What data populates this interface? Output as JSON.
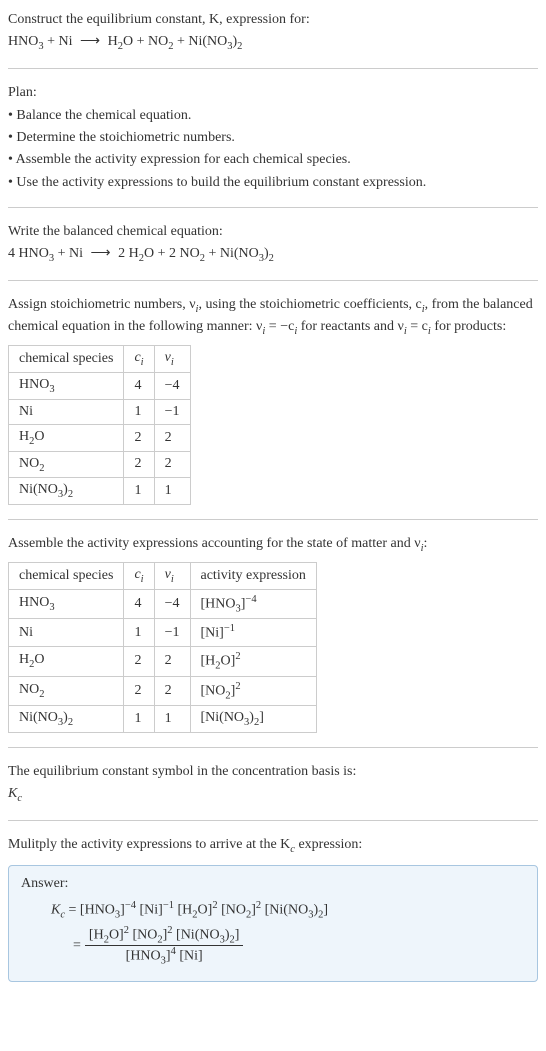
{
  "intro": {
    "l1": "Construct the equilibrium constant, K, expression for:",
    "eq_lhs1": "HNO",
    "eq_lhs1_sub": "3",
    "eq_plus1": " + Ni ",
    "arrow": "⟶",
    "eq_rhs1": " H",
    "eq_rhs1_sub": "2",
    "eq_rhs2": "O + NO",
    "eq_rhs2_sub": "2",
    "eq_rhs3": " + Ni(NO",
    "eq_rhs3_sub": "3",
    "eq_rhs4": ")",
    "eq_rhs4_sub": "2"
  },
  "plan": {
    "heading": "Plan:",
    "b1": "• Balance the chemical equation.",
    "b2": "• Determine the stoichiometric numbers.",
    "b3": "• Assemble the activity expression for each chemical species.",
    "b4": "• Use the activity expressions to build the equilibrium constant expression."
  },
  "balanced": {
    "heading": "Write the balanced chemical equation:",
    "l_a": "4 HNO",
    "l_a_sub": "3",
    "l_b": " + Ni ",
    "arrow": "⟶",
    "r_a": " 2 H",
    "r_a_sub": "2",
    "r_b": "O + 2 NO",
    "r_b_sub": "2",
    "r_c": " + Ni(NO",
    "r_c_sub": "3",
    "r_d": ")",
    "r_d_sub": "2"
  },
  "assign": {
    "p1a": "Assign stoichiometric numbers, ν",
    "p1a_sub": "i",
    "p1b": ", using the stoichiometric coefficients, c",
    "p1b_sub": "i",
    "p1c": ", from the balanced chemical equation in the following manner: ν",
    "p1c_sub": "i",
    "p1d": " = −c",
    "p1d_sub": "i",
    "p1e": " for reactants and ν",
    "p1e_sub": "i",
    "p1f": " = c",
    "p1f_sub": "i",
    "p1g": " for products:"
  },
  "table1": {
    "h1": "chemical species",
    "h2_a": "c",
    "h2_b": "i",
    "h3_a": "ν",
    "h3_b": "i",
    "rows": [
      {
        "sp_a": "HNO",
        "sp_sub": "3",
        "sp_c": "",
        "c": "4",
        "v": "−4"
      },
      {
        "sp_a": "Ni",
        "sp_sub": "",
        "sp_c": "",
        "c": "1",
        "v": "−1"
      },
      {
        "sp_a": "H",
        "sp_sub": "2",
        "sp_c": "O",
        "c": "2",
        "v": "2"
      },
      {
        "sp_a": "NO",
        "sp_sub": "2",
        "sp_c": "",
        "c": "2",
        "v": "2"
      },
      {
        "sp_a": "Ni(NO",
        "sp_sub": "3",
        "sp_c": ")",
        "sp_c_sub": "2",
        "c": "1",
        "v": "1"
      }
    ]
  },
  "assemble": {
    "heading_a": "Assemble the activity expressions accounting for the state of matter and ν",
    "heading_sub": "i",
    "heading_b": ":"
  },
  "table2": {
    "h1": "chemical species",
    "h2_a": "c",
    "h2_b": "i",
    "h3_a": "ν",
    "h3_b": "i",
    "h4": "activity expression",
    "rows": [
      {
        "sp_a": "HNO",
        "sp_sub": "3",
        "sp_c": "",
        "c": "4",
        "v": "−4",
        "ax_a": "[HNO",
        "ax_sub": "3",
        "ax_b": "]",
        "ax_sup": "−4"
      },
      {
        "sp_a": "Ni",
        "sp_sub": "",
        "sp_c": "",
        "c": "1",
        "v": "−1",
        "ax_a": "[Ni",
        "ax_sub": "",
        "ax_b": "]",
        "ax_sup": "−1"
      },
      {
        "sp_a": "H",
        "sp_sub": "2",
        "sp_c": "O",
        "c": "2",
        "v": "2",
        "ax_a": "[H",
        "ax_sub": "2",
        "ax_b": "O]",
        "ax_sup": "2"
      },
      {
        "sp_a": "NO",
        "sp_sub": "2",
        "sp_c": "",
        "c": "2",
        "v": "2",
        "ax_a": "[NO",
        "ax_sub": "2",
        "ax_b": "]",
        "ax_sup": "2"
      },
      {
        "sp_a": "Ni(NO",
        "sp_sub": "3",
        "sp_c": ")",
        "sp_c_sub": "2",
        "c": "1",
        "v": "1",
        "ax_a": "[Ni(NO",
        "ax_sub": "3",
        "ax_b": ")",
        "ax_b_sub": "2",
        "ax_c": "]",
        "ax_sup": ""
      }
    ]
  },
  "symbol": {
    "l1": "The equilibrium constant symbol in the concentration basis is:",
    "K": "K",
    "K_sub": "c"
  },
  "multiply": {
    "l1_a": "Mulitply the activity expressions to arrive at the K",
    "l1_sub": "c",
    "l1_b": " expression:"
  },
  "answer": {
    "label": "Answer:",
    "Kc": "K",
    "Kc_sub": "c",
    "eq": " = ",
    "t1_a": "[HNO",
    "t1_sub": "3",
    "t1_b": "]",
    "t1_sup": "−4",
    "t2_a": " [Ni]",
    "t2_sup": "−1",
    "t3_a": " [H",
    "t3_sub": "2",
    "t3_b": "O]",
    "t3_sup": "2",
    "t4_a": " [NO",
    "t4_sub": "2",
    "t4_b": "]",
    "t4_sup": "2",
    "t5_a": " [Ni(NO",
    "t5_sub": "3",
    "t5_b": ")",
    "t5_b_sub": "2",
    "t5_c": "]",
    "eq2": " = ",
    "num_a": "[H",
    "num_a_sub": "2",
    "num_b": "O]",
    "num_b_sup": "2",
    "num_c": " [NO",
    "num_c_sub": "2",
    "num_d": "]",
    "num_d_sup": "2",
    "num_e": " [Ni(NO",
    "num_e_sub": "3",
    "num_f": ")",
    "num_f_sub": "2",
    "num_g": "]",
    "den_a": "[HNO",
    "den_a_sub": "3",
    "den_b": "]",
    "den_b_sup": "4",
    "den_c": " [Ni]"
  }
}
